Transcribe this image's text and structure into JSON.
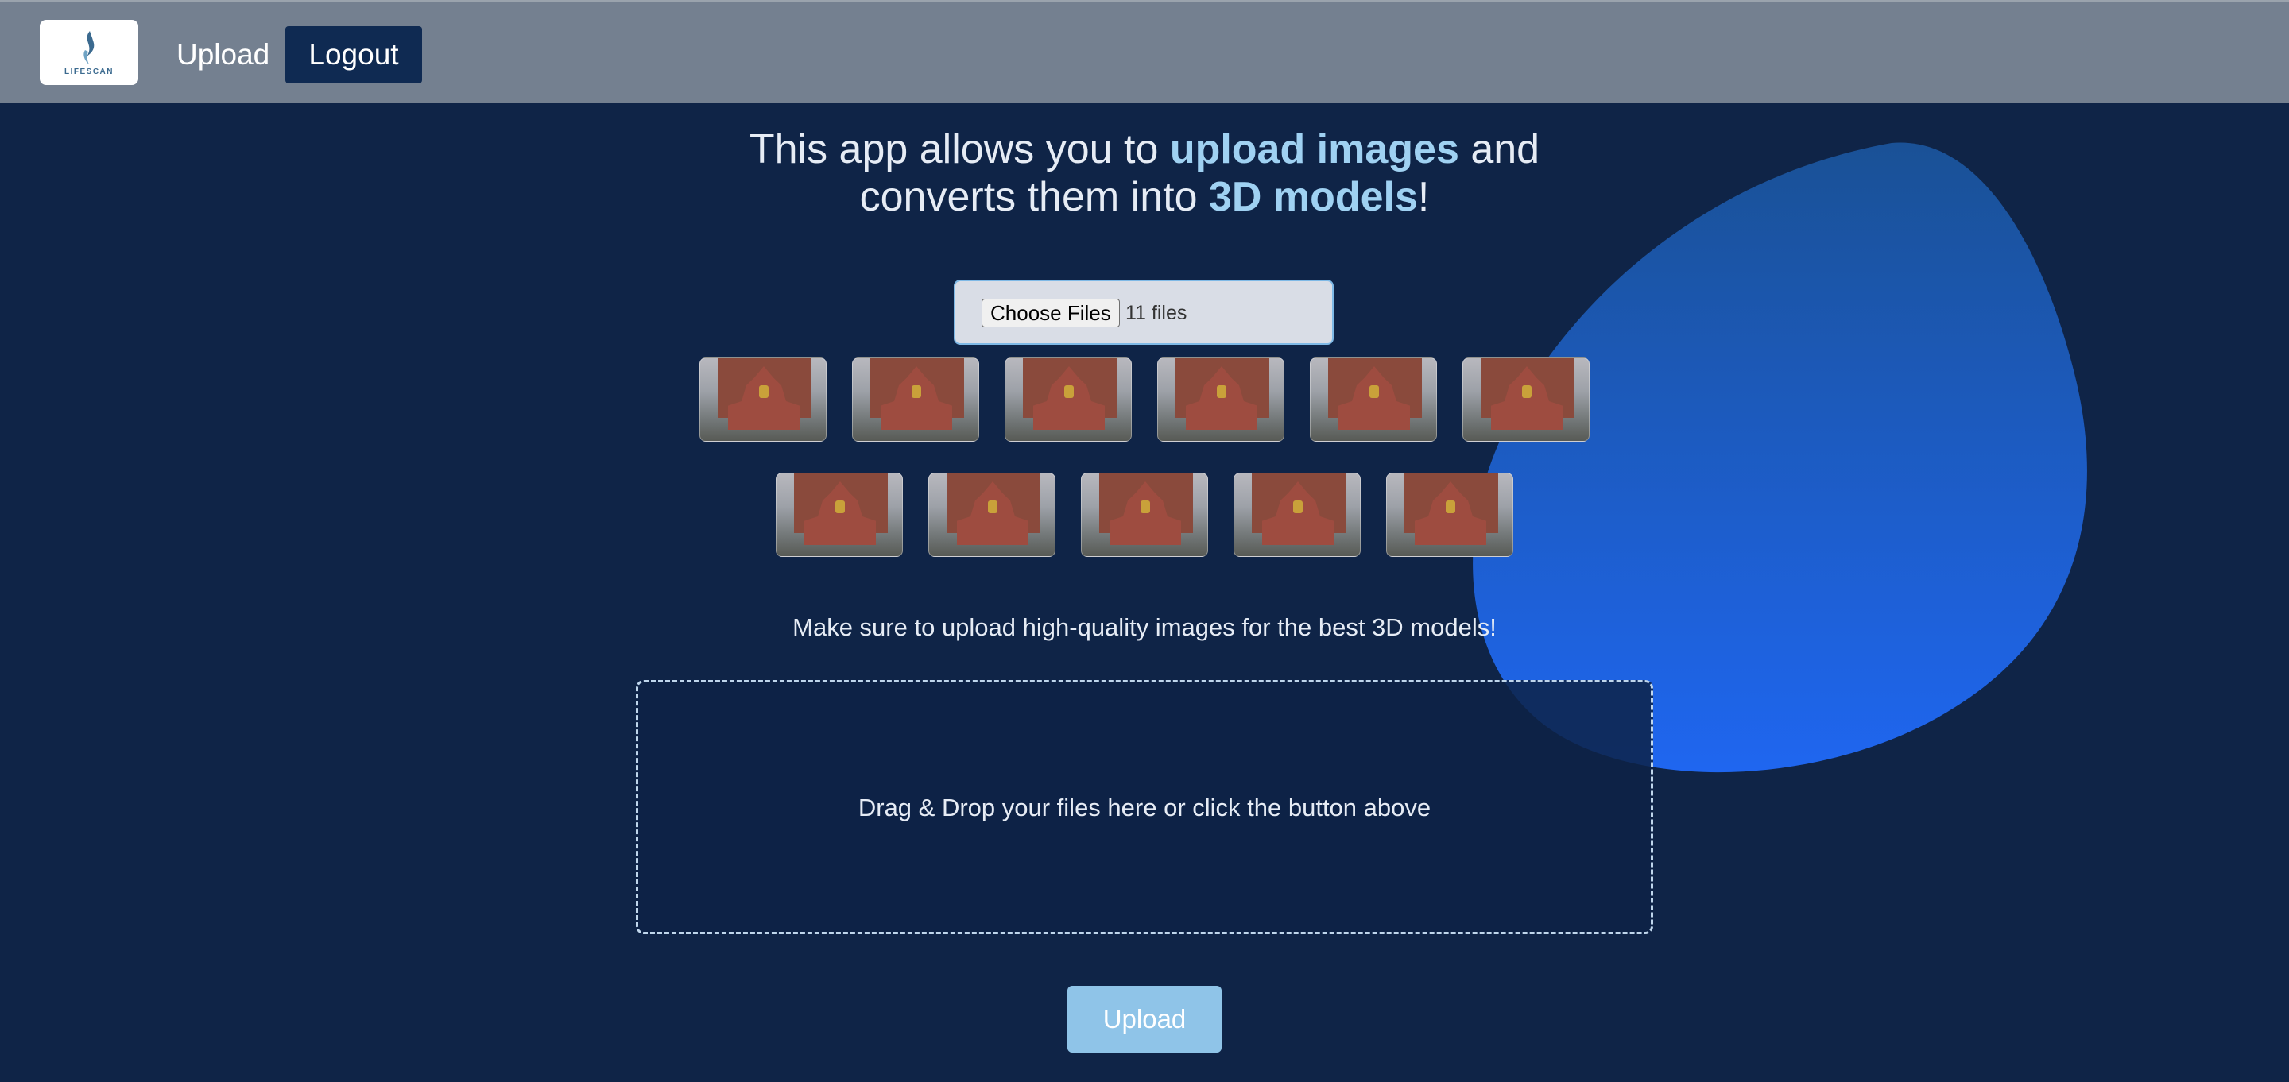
{
  "header": {
    "logo_text": "LIFESCAN",
    "nav_upload": "Upload",
    "nav_logout": "Logout"
  },
  "headline": {
    "part1": "This app allows you to ",
    "highlight1": "upload images",
    "part2": " and",
    "part3": "converts them into ",
    "highlight2": "3D models",
    "part4": "!"
  },
  "file_input": {
    "button_label": "Choose Files",
    "status": "11 files"
  },
  "thumbnails_count": 11,
  "hint": "Make sure to upload high-quality images for the best 3D models!",
  "dropzone": {
    "text": "Drag & Drop your files here or click the button above"
  },
  "upload_button": "Upload",
  "colors": {
    "background": "#0f2447",
    "header": "#748090",
    "accent_text": "#9fd1f2",
    "blob": "#1f66f0",
    "upload_button": "#8fc4e8"
  }
}
